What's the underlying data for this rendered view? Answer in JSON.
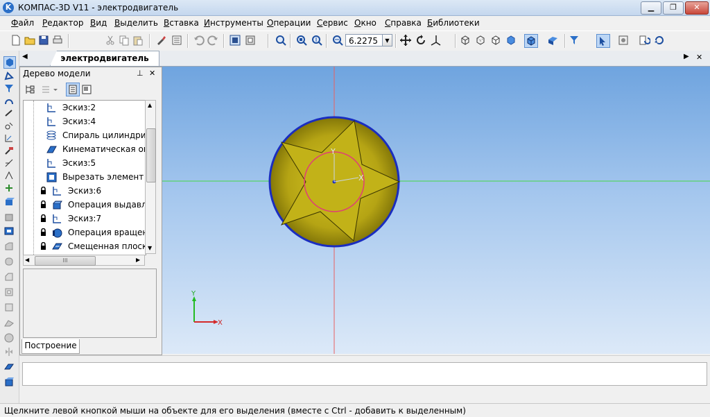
{
  "window": {
    "title": "КОМПАС-3D V11 - электродвигатель",
    "app_icon_letter": "K",
    "minimize_label": "▁",
    "maximize_label": "❐",
    "close_label": "✕"
  },
  "menu": {
    "items": [
      "Файл",
      "Редактор",
      "Вид",
      "Выделить",
      "Вставка",
      "Инструменты",
      "Операции",
      "Сервис",
      "Окно",
      "Справка",
      "Библиотеки"
    ]
  },
  "toolbar": {
    "zoom_value": "6.2275",
    "zoom_dropdown": "▼",
    "icons": [
      "new-file-icon",
      "open-folder-icon",
      "save-icon",
      "print-icon",
      "cut-icon",
      "copy-icon",
      "paste-icon",
      "format-brush-icon",
      "properties-icon",
      "undo-icon",
      "redo-icon",
      "manager-icon",
      "variables-icon",
      "zoom-fit-icon",
      "zoom-window-icon",
      "zoom-dynamic-icon",
      "zoom-in-icon",
      "pan-icon",
      "rotate-icon",
      "orientation-icon",
      "wireframe-icon",
      "hidden-lines-icon",
      "no-hidden-icon",
      "shaded-icon",
      "shaded-edges-icon",
      "perspective-icon",
      "filter-icon",
      "cursor-snap-icon",
      "view-manager-icon",
      "rebuild-icon"
    ]
  },
  "left_toolbar": {
    "icons": [
      "part-edit-icon",
      "sketch-icon",
      "filter-icon",
      "curve-icon",
      "surface-icon",
      "measure-icon",
      "dimensions-icon",
      "tools-icon",
      "lines-icon",
      "arc-icon",
      "axis-icon",
      "extrude-icon",
      "rotate-body-icon",
      "kinematic-icon",
      "cut-icon",
      "fillet-icon",
      "chamfer-icon",
      "shell-icon",
      "rib-icon",
      "array-icon",
      "sphere-icon",
      "mirror-icon",
      "plane-icon",
      "cut-plane-icon"
    ]
  },
  "document": {
    "tab_label": "электродвигатель",
    "tab_left_arrow": "◀",
    "tab_right_arrow": "▶",
    "tab_close": "✕"
  },
  "tree": {
    "title": "Дерево модели",
    "pin_label": "⊥",
    "close_label": "✕",
    "items": [
      {
        "label": "Эскиз:2",
        "icon": "sketch-icon",
        "locked": false
      },
      {
        "label": "Эскиз:4",
        "icon": "sketch-icon",
        "locked": false
      },
      {
        "label": "Спираль цилиндриче",
        "icon": "spiral-icon",
        "locked": false
      },
      {
        "label": "Кинематическая опер",
        "icon": "kinematic-icon",
        "locked": false
      },
      {
        "label": "Эскиз:5",
        "icon": "sketch-icon",
        "locked": false
      },
      {
        "label": "Вырезать элемент вы",
        "icon": "cut-extrude-icon",
        "locked": false
      },
      {
        "label": "Эскиз:6",
        "icon": "sketch-icon",
        "locked": true
      },
      {
        "label": "Операция выдавлие",
        "icon": "extrude-icon",
        "locked": true
      },
      {
        "label": "Эскиз:7",
        "icon": "sketch-icon",
        "locked": true
      },
      {
        "label": "Операция вращения",
        "icon": "revolve-icon",
        "locked": true
      },
      {
        "label": "Смещенная плоско",
        "icon": "plane-icon",
        "locked": true
      }
    ],
    "build_tab": "Построение",
    "scroll_grip": "III"
  },
  "viewport": {
    "axis_x": "X",
    "axis_y": "Y",
    "origin_label_x": "X",
    "origin_label_y": "Y",
    "colors": {
      "model_fill": "#c0b010",
      "model_outline": "#1a2dbf",
      "axis_green": "#44d844",
      "axis_red": "#e86060",
      "circle_pink": "#e03c78"
    }
  },
  "status": {
    "text": "Щелкните левой кнопкой мыши на объекте для его выделения (вместе с Ctrl - добавить к выделенным)"
  }
}
